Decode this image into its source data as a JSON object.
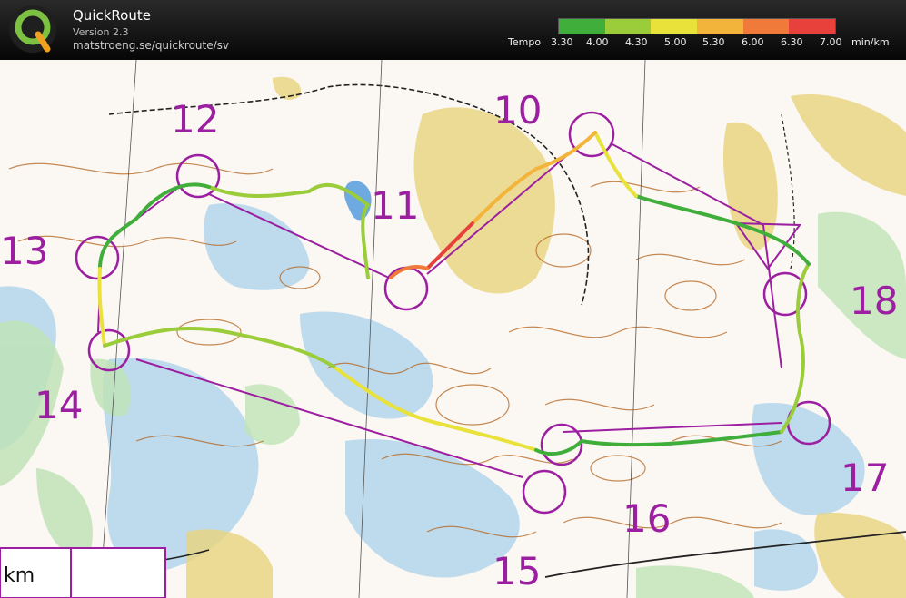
{
  "app": {
    "title": "QuickRoute",
    "version": "Version 2.3",
    "url": "matstroeng.se/quickroute/sv"
  },
  "legend": {
    "label": "Tempo",
    "ticks": [
      "3.30",
      "4.00",
      "4.30",
      "5.00",
      "5.30",
      "6.00",
      "6.30",
      "7.00"
    ],
    "unit": "min/km",
    "colors": [
      "#3fae3a",
      "#9bcc3a",
      "#e8e23a",
      "#f2b43a",
      "#ef7a3a",
      "#e8403a"
    ]
  },
  "map": {
    "controls": [
      "10",
      "11",
      "12",
      "13",
      "14",
      "15",
      "16",
      "17",
      "18"
    ],
    "scale_label": "km",
    "colors": {
      "course": "#9b1fa0",
      "contour": "#b4641e",
      "water": "#9ccbe8",
      "vegetation": "#c8e6c0",
      "yellow": "#e8d27a"
    }
  }
}
